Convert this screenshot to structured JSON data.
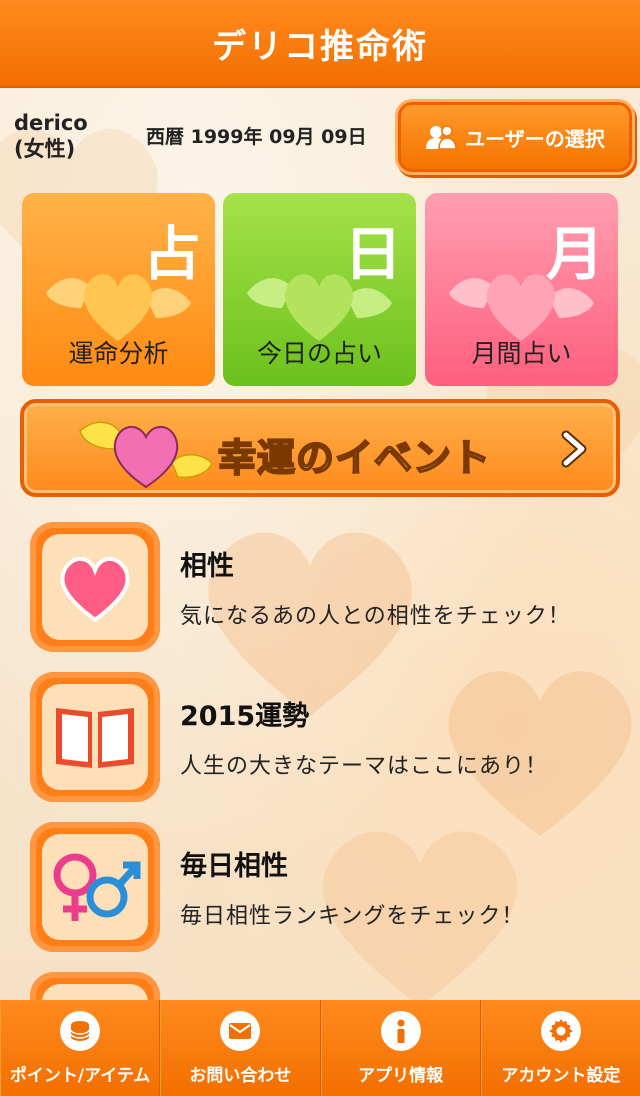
{
  "header": {
    "title": "デリコ推命術"
  },
  "user": {
    "name_line1": "derico",
    "name_line2": "(女性)",
    "dob": "西暦 1999年 09月 09日",
    "select_button": "ユーザーの選択"
  },
  "tiles": [
    {
      "kanji": "占",
      "label": "運命分析",
      "icon": "winged-hearts-icon",
      "color": "#ff8a12"
    },
    {
      "kanji": "日",
      "label": "今日の占い",
      "icon": "winged-hearts-icon",
      "color": "#6bc11c"
    },
    {
      "kanji": "月",
      "label": "月間占い",
      "icon": "winged-hearts-icon",
      "color": "#ff5f7e"
    }
  ],
  "event_banner": {
    "label": "幸運のイベント",
    "icon": "winged-heart-icon"
  },
  "menu": [
    {
      "title": "相性",
      "desc": "気になるあの人との相性をチェック！",
      "icon": "heart-icon"
    },
    {
      "title": "2015運勢",
      "desc": "人生の大きなテーマはここにあり！",
      "icon": "book-icon"
    },
    {
      "title": "毎日相性",
      "desc": "毎日相性ランキングをチェック！",
      "icon": "gender-symbols-icon"
    }
  ],
  "tabbar": [
    {
      "label": "ポイント/アイテム",
      "icon": "coins-icon"
    },
    {
      "label": "お問い合わせ",
      "icon": "mail-icon"
    },
    {
      "label": "アプリ情報",
      "icon": "info-icon"
    },
    {
      "label": "アカウント設定",
      "icon": "gear-icon"
    }
  ],
  "colors": {
    "accent": "#f36f00",
    "background": "#f7e6cc"
  }
}
